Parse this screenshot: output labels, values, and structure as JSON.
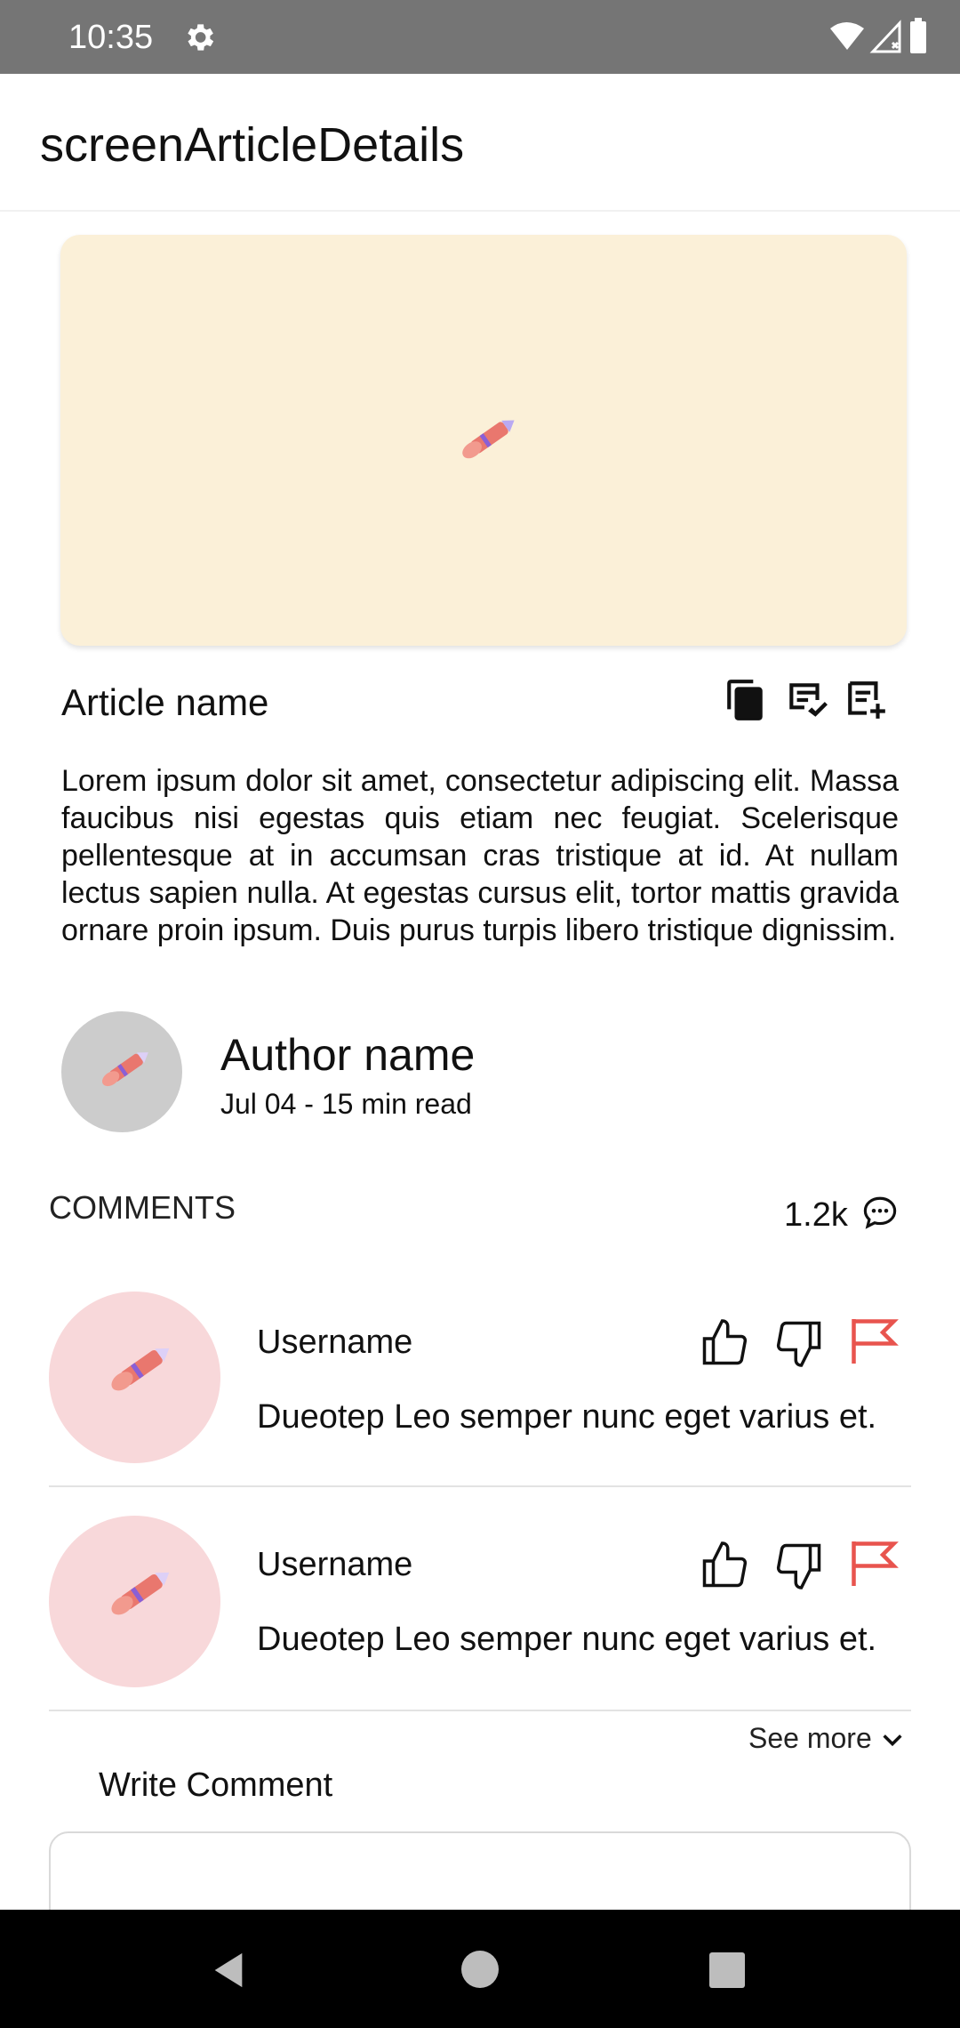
{
  "status_bar": {
    "time": "10:35"
  },
  "app_bar": {
    "title": "screenArticleDetails"
  },
  "article": {
    "name": "Article name",
    "body": "Lorem ipsum dolor sit amet, consectetur adipiscing elit. Massa faucibus nisi egestas quis etiam nec feugiat. Scelerisque pellentesque at in accumsan cras tristique at id. At nullam lectus sapien nulla. At egestas cursus elit, tortor mattis gravida ornare proin ipsum. Duis purus turpis libero tristique dignissim.",
    "actions": [
      "copy-icon",
      "rate-review-icon",
      "playlist-add-icon"
    ]
  },
  "author": {
    "name": "Author name",
    "meta": "Jul 04 - 15 min read"
  },
  "comments": {
    "heading": "COMMENTS",
    "count": "1.2k",
    "items": [
      {
        "username": "Username",
        "text": "Dueotep Leo semper nunc eget varius et."
      },
      {
        "username": "Username",
        "text": "Dueotep Leo semper nunc eget varius et."
      }
    ],
    "see_more": "See more"
  },
  "write_comment": {
    "label": "Write Comment",
    "value": ""
  },
  "colors": {
    "status_bar": "#757575",
    "hero_bg": "#fbf0d8",
    "comment_avatar_bg": "#f8d8da",
    "flag": "#e8544e"
  }
}
